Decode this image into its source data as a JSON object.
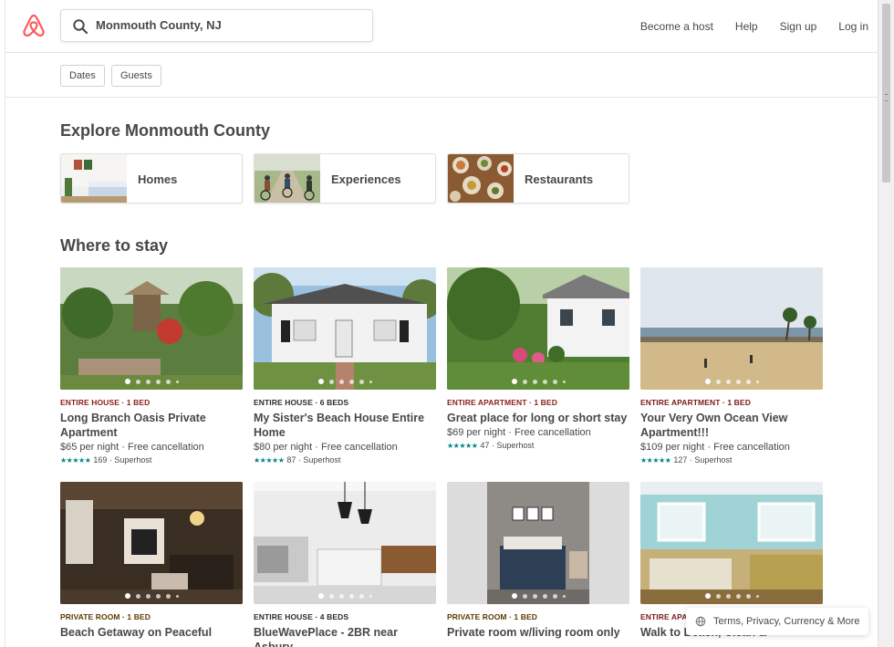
{
  "search": {
    "value": "Monmouth County, NJ"
  },
  "nav": {
    "become_host": "Become a host",
    "help": "Help",
    "sign_up": "Sign up",
    "log_in": "Log in"
  },
  "filters": {
    "dates": "Dates",
    "guests": "Guests"
  },
  "explore": {
    "heading": "Explore Monmouth County",
    "cards": [
      {
        "label": "Homes"
      },
      {
        "label": "Experiences"
      },
      {
        "label": "Restaurants"
      }
    ]
  },
  "stay": {
    "heading": "Where to stay",
    "listings": [
      {
        "kind": "ENTIRE HOUSE · 1 BED",
        "title": "Long Branch Oasis Private Apartment",
        "price": "$65 per night · Free cancellation",
        "rating": "169 · Superhost"
      },
      {
        "kind": "ENTIRE HOUSE · 6 BEDS",
        "title": "My Sister's Beach House Entire Home",
        "price": "$80 per night · Free cancellation",
        "rating": "87 · Superhost"
      },
      {
        "kind": "ENTIRE APARTMENT · 1 BED",
        "title": "Great place for long or short stay",
        "price": "$69 per night · Free cancellation",
        "rating": "47 · Superhost"
      },
      {
        "kind": "ENTIRE APARTMENT · 1 BED",
        "title": "Your Very Own Ocean View Apartment!!!",
        "price": "$109 per night · Free cancellation",
        "rating": "127 · Superhost"
      },
      {
        "kind": "PRIVATE ROOM · 1 BED",
        "title": "Beach Getaway on Peaceful"
      },
      {
        "kind": "ENTIRE HOUSE · 4 BEDS",
        "title": "BlueWavePlace - 2BR near Asbury"
      },
      {
        "kind": "PRIVATE ROOM · 1 BED",
        "title": "Private room w/living room only"
      },
      {
        "kind": "ENTIRE APA",
        "title": "Walk to Beach, Clean &"
      }
    ]
  },
  "footer": {
    "label": "Terms, Privacy, Currency & More"
  },
  "colors": {
    "brand": "#FF5A5F",
    "kind_house": "#8A1D1D",
    "kind_apartment": "#7A1A1A",
    "kind_private": "#5B3A00",
    "star": "#008489"
  }
}
